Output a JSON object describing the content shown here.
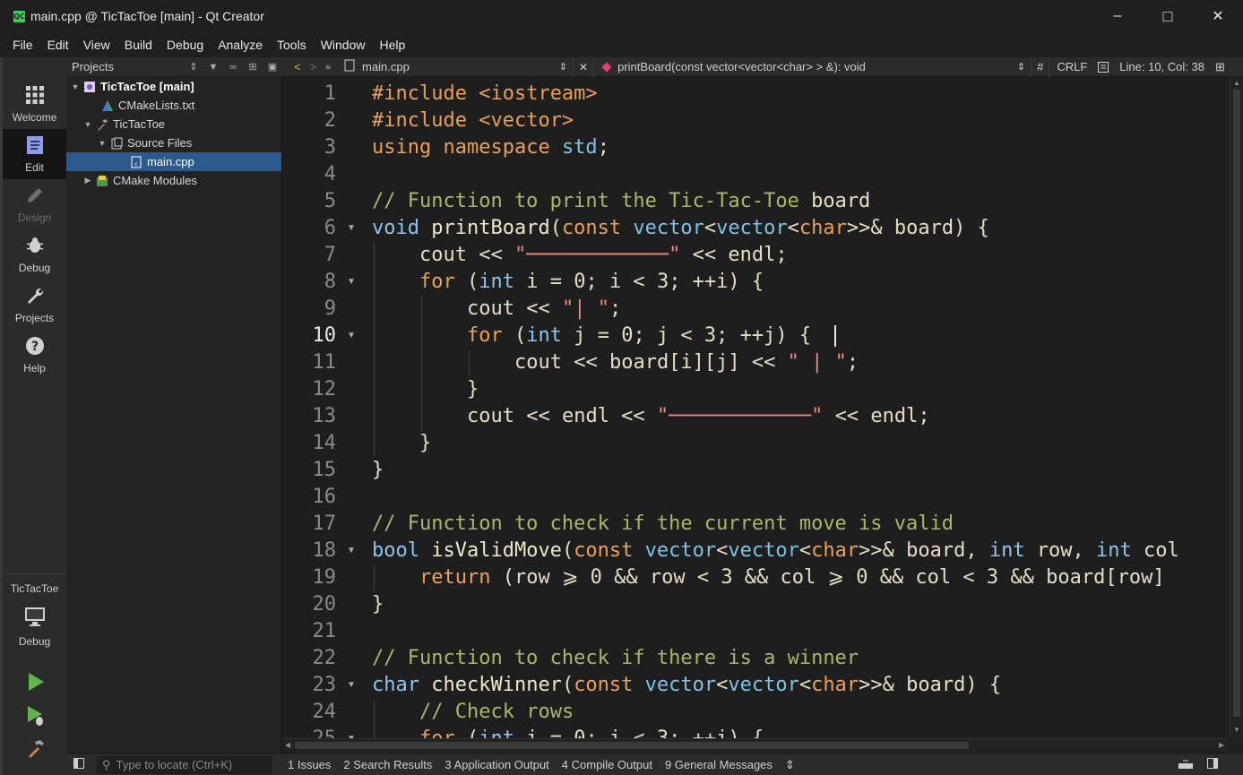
{
  "window": {
    "title": "main.cpp @ TicTacToe [main] - Qt Creator",
    "app_icon": "QC",
    "minimize": "–",
    "maximize": "□",
    "close": "✕"
  },
  "menu": [
    "File",
    "Edit",
    "View",
    "Build",
    "Debug",
    "Analyze",
    "Tools",
    "Window",
    "Help"
  ],
  "modes": [
    {
      "label": "Welcome",
      "icon": "grid-icon"
    },
    {
      "label": "Edit",
      "icon": "document-icon"
    },
    {
      "label": "Design",
      "icon": "pencil-icon"
    },
    {
      "label": "Debug",
      "icon": "bug-icon"
    },
    {
      "label": "Projects",
      "icon": "wrench-icon"
    },
    {
      "label": "Help",
      "icon": "question-icon"
    }
  ],
  "kit": {
    "project": "TicTacToe",
    "config": "Debug"
  },
  "projects_panel": {
    "title": "Projects",
    "tree": [
      {
        "label": "TicTacToe [main]",
        "level": 0,
        "arrow": "▼",
        "icon": "project-icon",
        "bold": true
      },
      {
        "label": "CMakeLists.txt",
        "level": 1,
        "arrow": "",
        "icon": "cmake-icon"
      },
      {
        "label": "TicTacToe",
        "level": 1,
        "arrow": "▼",
        "icon": "hammer-icon"
      },
      {
        "label": "Source Files",
        "level": 2,
        "arrow": "▼",
        "icon": "folder-icon"
      },
      {
        "label": "main.cpp",
        "level": 3,
        "arrow": "",
        "icon": "cpp-file-icon",
        "selected": true
      },
      {
        "label": "CMake Modules",
        "level": 1,
        "arrow": "▶",
        "icon": "modules-icon"
      }
    ]
  },
  "editor_toolbar": {
    "file": "main.cpp",
    "symbol": "printBoard(const vector<vector<char> > &): void",
    "hash": "#",
    "line_ending": "CRLF",
    "position": "Line: 10, Col: 38"
  },
  "editor": {
    "current_line": 10,
    "lines": [
      {
        "n": "1",
        "indent": 0,
        "fold": "",
        "segs": [
          [
            "#include ",
            "#e8a05c"
          ],
          [
            "<iostream>",
            "#e8a05c"
          ]
        ]
      },
      {
        "n": "2",
        "indent": 0,
        "fold": "",
        "segs": [
          [
            "#include ",
            "#e8a05c"
          ],
          [
            "<vector>",
            "#e8a05c"
          ]
        ]
      },
      {
        "n": "3",
        "indent": 0,
        "fold": "",
        "segs": [
          [
            "using ",
            "#e8a05c"
          ],
          [
            "namespace ",
            "#e8a05c"
          ],
          [
            "std",
            "#7dc3e8"
          ],
          [
            ";",
            "#e8ddc4"
          ]
        ]
      },
      {
        "n": "4",
        "indent": 0,
        "fold": "",
        "segs": []
      },
      {
        "n": "5",
        "indent": 0,
        "fold": "",
        "segs": [
          [
            "// Function to print the Tic-Tac-Toe ",
            "#a8b86a"
          ],
          [
            "board",
            "#e8ddc4"
          ]
        ]
      },
      {
        "n": "6",
        "indent": 0,
        "fold": "▼",
        "segs": [
          [
            "void ",
            "#8fc3f0"
          ],
          [
            "printBoard",
            "#f0e6c8"
          ],
          [
            "(",
            "#e8ddc4"
          ],
          [
            "const ",
            "#e8a05c"
          ],
          [
            "vector",
            "#7dc3e8"
          ],
          [
            "<",
            "#e8ddc4"
          ],
          [
            "vector",
            "#7dc3e8"
          ],
          [
            "<",
            "#e8ddc4"
          ],
          [
            "char",
            "#e8a05c"
          ],
          [
            ">>& board) {",
            "#e8ddc4"
          ]
        ]
      },
      {
        "n": "7",
        "indent": 1,
        "fold": "",
        "segs": [
          [
            "cout << ",
            "#e8ddc4"
          ],
          [
            "\"────────────\"",
            "#f08a7a"
          ],
          [
            " << endl;",
            "#e8ddc4"
          ]
        ]
      },
      {
        "n": "8",
        "indent": 1,
        "fold": "▼",
        "segs": [
          [
            "for ",
            "#e8a05c"
          ],
          [
            "(",
            "#e8ddc4"
          ],
          [
            "int ",
            "#8fc3f0"
          ],
          [
            "i = ",
            "#e8ddc4"
          ],
          [
            "0",
            "#e8ddc4"
          ],
          [
            "; i < ",
            "#e8ddc4"
          ],
          [
            "3",
            "#e8ddc4"
          ],
          [
            "; ++i) {",
            "#e8ddc4"
          ]
        ]
      },
      {
        "n": "9",
        "indent": 2,
        "fold": "",
        "segs": [
          [
            "cout << ",
            "#e8ddc4"
          ],
          [
            "\"| \"",
            "#f08a7a"
          ],
          [
            ";",
            "#e8ddc4"
          ]
        ]
      },
      {
        "n": "10",
        "indent": 2,
        "fold": "▼",
        "segs": [
          [
            "for ",
            "#e8a05c"
          ],
          [
            "(",
            "#e8ddc4"
          ],
          [
            "int ",
            "#8fc3f0"
          ],
          [
            "j = 0; j < 3; ++j) {",
            "#e8ddc4"
          ]
        ]
      },
      {
        "n": "11",
        "indent": 3,
        "fold": "",
        "segs": [
          [
            "cout << board[i][j] << ",
            "#e8ddc4"
          ],
          [
            "\" | \"",
            "#f08a7a"
          ],
          [
            ";",
            "#e8ddc4"
          ]
        ]
      },
      {
        "n": "12",
        "indent": 2,
        "fold": "",
        "segs": [
          [
            "}",
            "#e8ddc4"
          ]
        ]
      },
      {
        "n": "13",
        "indent": 2,
        "fold": "",
        "segs": [
          [
            "cout << endl << ",
            "#e8ddc4"
          ],
          [
            "\"────────────\"",
            "#f08a7a"
          ],
          [
            " << endl;",
            "#e8ddc4"
          ]
        ]
      },
      {
        "n": "14",
        "indent": 1,
        "fold": "",
        "segs": [
          [
            "}",
            "#e8ddc4"
          ]
        ]
      },
      {
        "n": "15",
        "indent": 0,
        "fold": "",
        "segs": [
          [
            "}",
            "#e8ddc4"
          ]
        ]
      },
      {
        "n": "16",
        "indent": 0,
        "fold": "",
        "segs": []
      },
      {
        "n": "17",
        "indent": 0,
        "fold": "",
        "segs": [
          [
            "// Function to check if the current move is valid",
            "#a8b86a"
          ]
        ]
      },
      {
        "n": "18",
        "indent": 0,
        "fold": "▼",
        "segs": [
          [
            "bool ",
            "#8fc3f0"
          ],
          [
            "isValidMove",
            "#f0e6c8"
          ],
          [
            "(",
            "#e8ddc4"
          ],
          [
            "const ",
            "#e8a05c"
          ],
          [
            "vector",
            "#7dc3e8"
          ],
          [
            "<",
            "#e8ddc4"
          ],
          [
            "vector",
            "#7dc3e8"
          ],
          [
            "<",
            "#e8ddc4"
          ],
          [
            "char",
            "#e8a05c"
          ],
          [
            ">>& board, ",
            "#e8ddc4"
          ],
          [
            "int ",
            "#8fc3f0"
          ],
          [
            "row, ",
            "#e8ddc4"
          ],
          [
            "int ",
            "#8fc3f0"
          ],
          [
            "col",
            "#e8ddc4"
          ]
        ]
      },
      {
        "n": "19",
        "indent": 1,
        "fold": "",
        "segs": [
          [
            "return ",
            "#e8a05c"
          ],
          [
            "(row ⩾ 0 && row < 3 && col ⩾ 0 && col < 3 && board[row]",
            "#e8ddc4"
          ]
        ]
      },
      {
        "n": "20",
        "indent": 0,
        "fold": "",
        "segs": [
          [
            "}",
            "#e8ddc4"
          ]
        ]
      },
      {
        "n": "21",
        "indent": 0,
        "fold": "",
        "segs": []
      },
      {
        "n": "22",
        "indent": 0,
        "fold": "",
        "segs": [
          [
            "// Function to check if there is a winner",
            "#a8b86a"
          ]
        ]
      },
      {
        "n": "23",
        "indent": 0,
        "fold": "▼",
        "segs": [
          [
            "char ",
            "#8fc3f0"
          ],
          [
            "checkWinner",
            "#f0e6c8"
          ],
          [
            "(",
            "#e8ddc4"
          ],
          [
            "const ",
            "#e8a05c"
          ],
          [
            "vector",
            "#7dc3e8"
          ],
          [
            "<",
            "#e8ddc4"
          ],
          [
            "vector",
            "#7dc3e8"
          ],
          [
            "<",
            "#e8ddc4"
          ],
          [
            "char",
            "#e8a05c"
          ],
          [
            ">>& board) {",
            "#e8ddc4"
          ]
        ]
      },
      {
        "n": "24",
        "indent": 1,
        "fold": "",
        "segs": [
          [
            "// Check rows",
            "#a8b86a"
          ]
        ]
      },
      {
        "n": "25",
        "indent": 1,
        "fold": "▼",
        "segs": [
          [
            "for ",
            "#e8a05c"
          ],
          [
            "(",
            "#e8ddc4"
          ],
          [
            "int ",
            "#8fc3f0"
          ],
          [
            "i = 0; i < 3; ++i) {",
            "#e8ddc4"
          ]
        ]
      }
    ]
  },
  "locator_placeholder": "Type to locate (Ctrl+K)",
  "output_panes": [
    "1  Issues",
    "2  Search Results",
    "3  Application Output",
    "4  Compile Output",
    "9  General Messages"
  ],
  "pane_more": "⇕"
}
